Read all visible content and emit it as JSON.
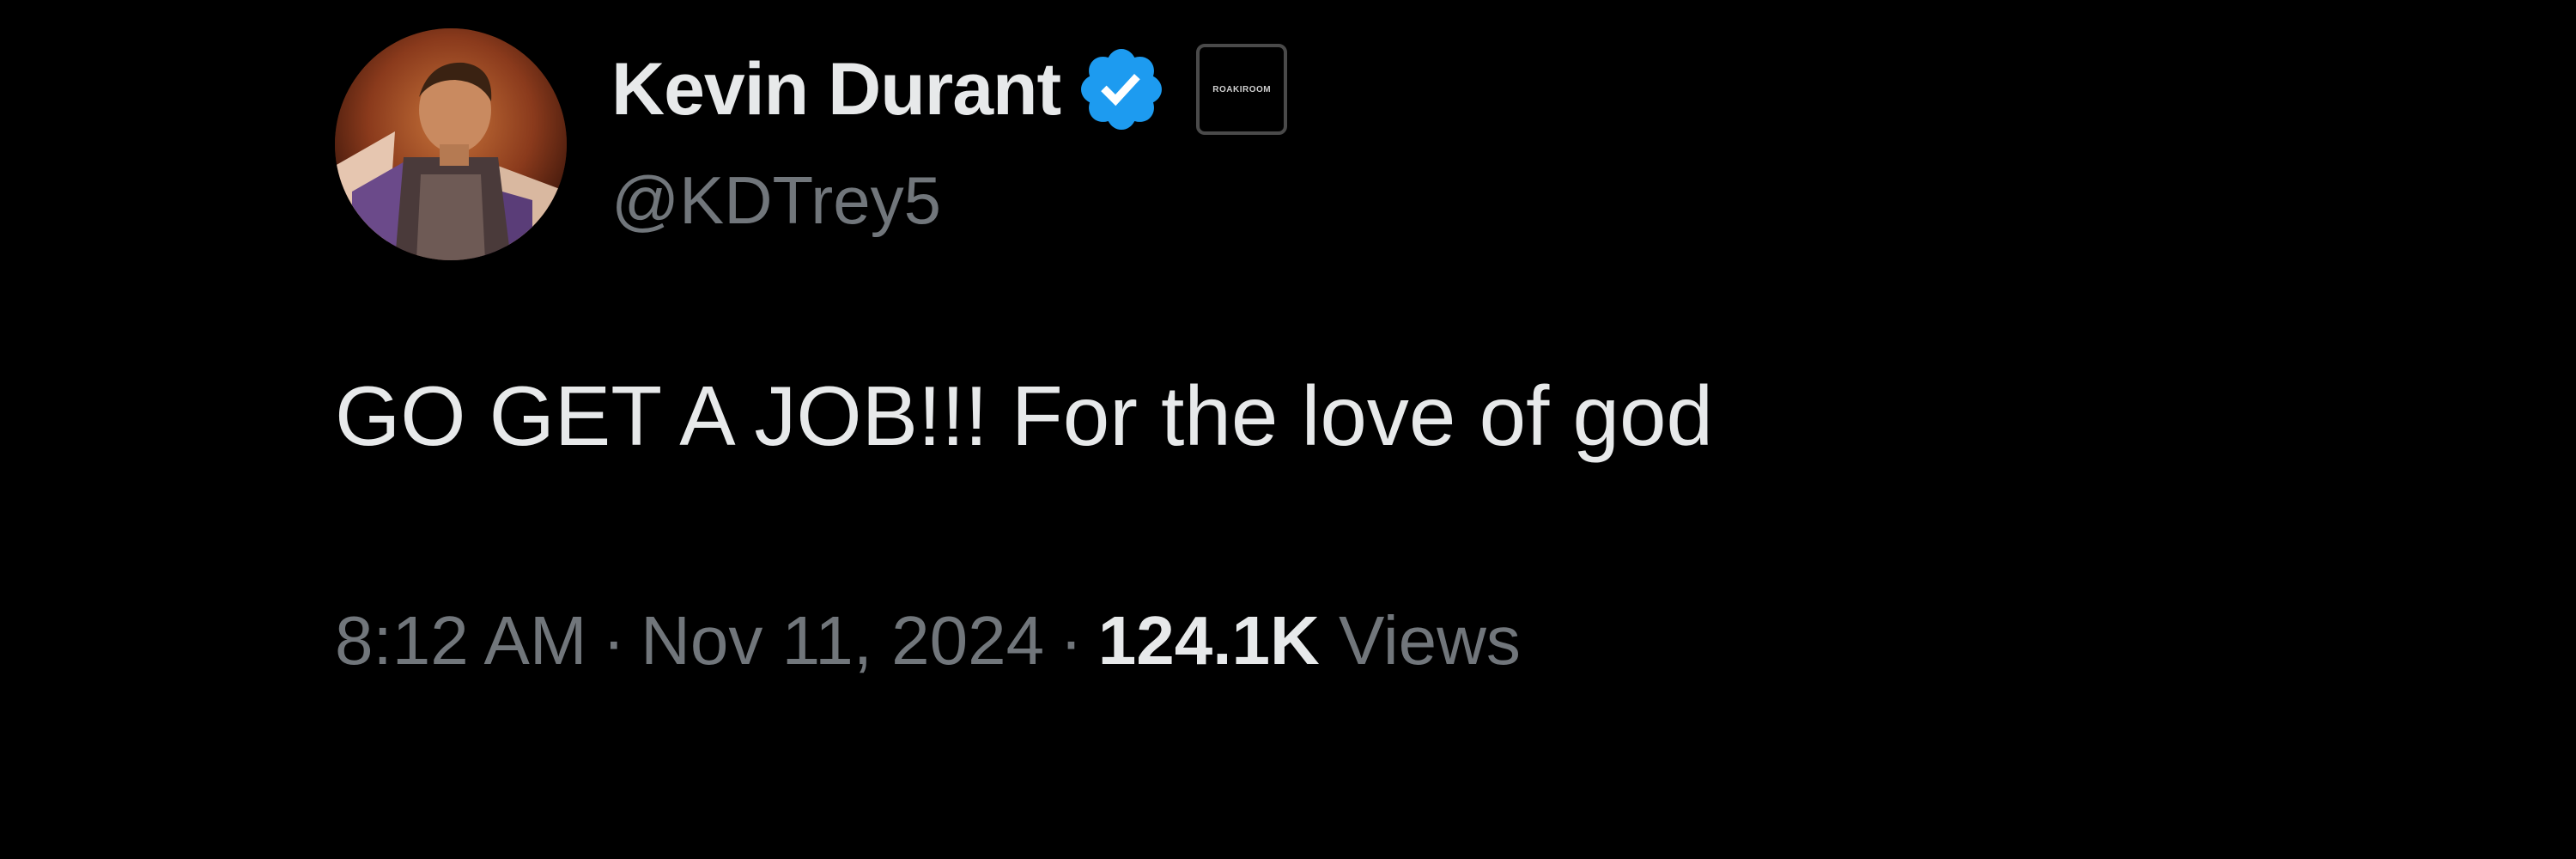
{
  "tweet": {
    "display_name": "Kevin Durant",
    "handle": "@KDTrey5",
    "affiliate_badge_text": "ROAKIROOM",
    "text": "GO GET A JOB!!! For the love of god",
    "time": "8:12 AM",
    "separator": "·",
    "date": "Nov 11, 2024",
    "views_count": "124.1K",
    "views_label": "Views"
  },
  "colors": {
    "background": "#000000",
    "primary_text": "#e7e9ea",
    "secondary_text": "#71767b",
    "verified_blue": "#1d9bf0"
  },
  "icons": {
    "verified": "verified-badge-icon",
    "affiliate": "affiliate-badge-icon"
  }
}
